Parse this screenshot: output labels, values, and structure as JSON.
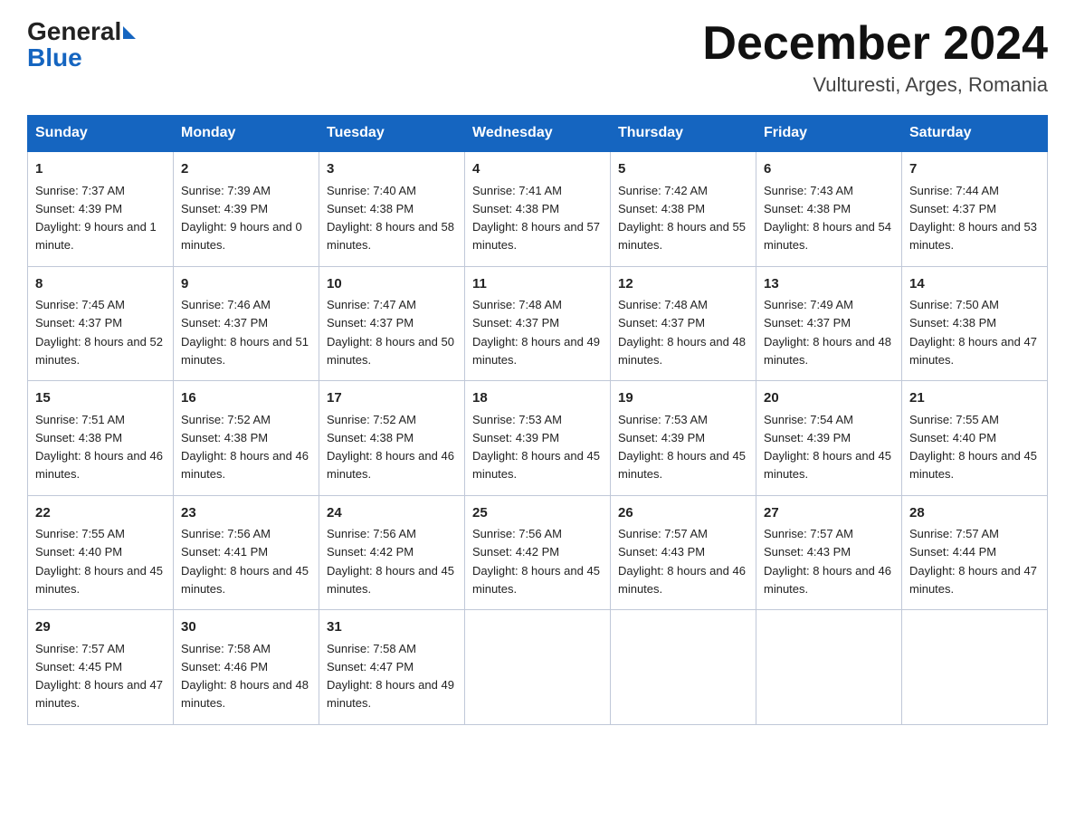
{
  "header": {
    "logo_text_black": "General",
    "logo_text_blue": "Blue",
    "month_title": "December 2024",
    "location": "Vulturesti, Arges, Romania"
  },
  "days_of_week": [
    "Sunday",
    "Monday",
    "Tuesday",
    "Wednesday",
    "Thursday",
    "Friday",
    "Saturday"
  ],
  "weeks": [
    [
      {
        "day": "1",
        "sunrise": "7:37 AM",
        "sunset": "4:39 PM",
        "daylight": "9 hours and 1 minute."
      },
      {
        "day": "2",
        "sunrise": "7:39 AM",
        "sunset": "4:39 PM",
        "daylight": "9 hours and 0 minutes."
      },
      {
        "day": "3",
        "sunrise": "7:40 AM",
        "sunset": "4:38 PM",
        "daylight": "8 hours and 58 minutes."
      },
      {
        "day": "4",
        "sunrise": "7:41 AM",
        "sunset": "4:38 PM",
        "daylight": "8 hours and 57 minutes."
      },
      {
        "day": "5",
        "sunrise": "7:42 AM",
        "sunset": "4:38 PM",
        "daylight": "8 hours and 55 minutes."
      },
      {
        "day": "6",
        "sunrise": "7:43 AM",
        "sunset": "4:38 PM",
        "daylight": "8 hours and 54 minutes."
      },
      {
        "day": "7",
        "sunrise": "7:44 AM",
        "sunset": "4:37 PM",
        "daylight": "8 hours and 53 minutes."
      }
    ],
    [
      {
        "day": "8",
        "sunrise": "7:45 AM",
        "sunset": "4:37 PM",
        "daylight": "8 hours and 52 minutes."
      },
      {
        "day": "9",
        "sunrise": "7:46 AM",
        "sunset": "4:37 PM",
        "daylight": "8 hours and 51 minutes."
      },
      {
        "day": "10",
        "sunrise": "7:47 AM",
        "sunset": "4:37 PM",
        "daylight": "8 hours and 50 minutes."
      },
      {
        "day": "11",
        "sunrise": "7:48 AM",
        "sunset": "4:37 PM",
        "daylight": "8 hours and 49 minutes."
      },
      {
        "day": "12",
        "sunrise": "7:48 AM",
        "sunset": "4:37 PM",
        "daylight": "8 hours and 48 minutes."
      },
      {
        "day": "13",
        "sunrise": "7:49 AM",
        "sunset": "4:37 PM",
        "daylight": "8 hours and 48 minutes."
      },
      {
        "day": "14",
        "sunrise": "7:50 AM",
        "sunset": "4:38 PM",
        "daylight": "8 hours and 47 minutes."
      }
    ],
    [
      {
        "day": "15",
        "sunrise": "7:51 AM",
        "sunset": "4:38 PM",
        "daylight": "8 hours and 46 minutes."
      },
      {
        "day": "16",
        "sunrise": "7:52 AM",
        "sunset": "4:38 PM",
        "daylight": "8 hours and 46 minutes."
      },
      {
        "day": "17",
        "sunrise": "7:52 AM",
        "sunset": "4:38 PM",
        "daylight": "8 hours and 46 minutes."
      },
      {
        "day": "18",
        "sunrise": "7:53 AM",
        "sunset": "4:39 PM",
        "daylight": "8 hours and 45 minutes."
      },
      {
        "day": "19",
        "sunrise": "7:53 AM",
        "sunset": "4:39 PM",
        "daylight": "8 hours and 45 minutes."
      },
      {
        "day": "20",
        "sunrise": "7:54 AM",
        "sunset": "4:39 PM",
        "daylight": "8 hours and 45 minutes."
      },
      {
        "day": "21",
        "sunrise": "7:55 AM",
        "sunset": "4:40 PM",
        "daylight": "8 hours and 45 minutes."
      }
    ],
    [
      {
        "day": "22",
        "sunrise": "7:55 AM",
        "sunset": "4:40 PM",
        "daylight": "8 hours and 45 minutes."
      },
      {
        "day": "23",
        "sunrise": "7:56 AM",
        "sunset": "4:41 PM",
        "daylight": "8 hours and 45 minutes."
      },
      {
        "day": "24",
        "sunrise": "7:56 AM",
        "sunset": "4:42 PM",
        "daylight": "8 hours and 45 minutes."
      },
      {
        "day": "25",
        "sunrise": "7:56 AM",
        "sunset": "4:42 PM",
        "daylight": "8 hours and 45 minutes."
      },
      {
        "day": "26",
        "sunrise": "7:57 AM",
        "sunset": "4:43 PM",
        "daylight": "8 hours and 46 minutes."
      },
      {
        "day": "27",
        "sunrise": "7:57 AM",
        "sunset": "4:43 PM",
        "daylight": "8 hours and 46 minutes."
      },
      {
        "day": "28",
        "sunrise": "7:57 AM",
        "sunset": "4:44 PM",
        "daylight": "8 hours and 47 minutes."
      }
    ],
    [
      {
        "day": "29",
        "sunrise": "7:57 AM",
        "sunset": "4:45 PM",
        "daylight": "8 hours and 47 minutes."
      },
      {
        "day": "30",
        "sunrise": "7:58 AM",
        "sunset": "4:46 PM",
        "daylight": "8 hours and 48 minutes."
      },
      {
        "day": "31",
        "sunrise": "7:58 AM",
        "sunset": "4:47 PM",
        "daylight": "8 hours and 49 minutes."
      },
      null,
      null,
      null,
      null
    ]
  ]
}
